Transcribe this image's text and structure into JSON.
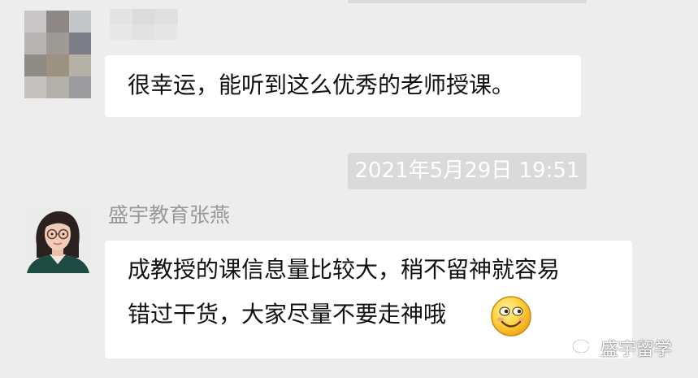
{
  "messages": [
    {
      "sender_name": "",
      "text": "很幸运，能听到这么优秀的老师授课。"
    },
    {
      "sender_name": "盛宇教育张燕",
      "lines": [
        "成教授的课信息量比较大，稍不留神就容易",
        "错过干货，大家尽量不要走神哦"
      ],
      "emoji": "smiling-face-emoji"
    }
  ],
  "timestamp": "2021年5月29日 19:51",
  "watermark": {
    "icon": "wechat-official-account-icon",
    "text": "盛宇留学"
  },
  "colors": {
    "background": "#ededed",
    "bubble": "#ffffff",
    "timestamp_bg": "#dadada",
    "sender_name": "#999999"
  }
}
